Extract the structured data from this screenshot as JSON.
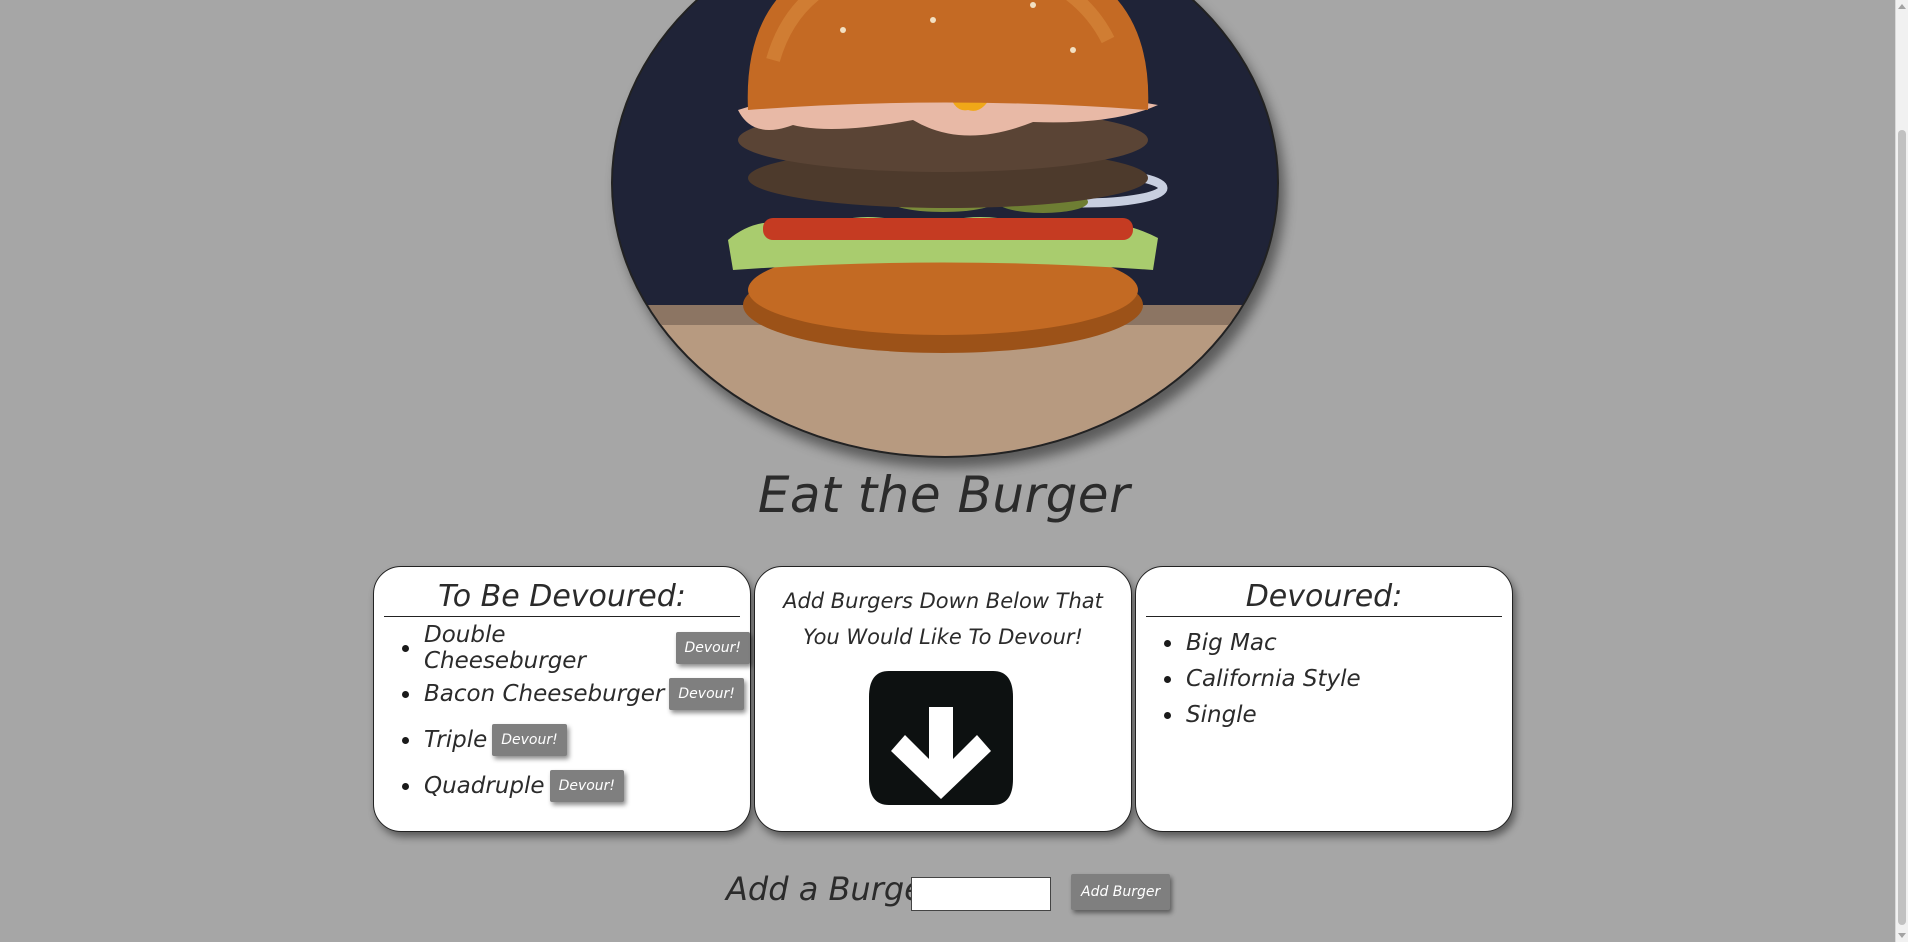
{
  "page": {
    "title": "Eat the Burger"
  },
  "hero": {
    "icon": "burger-photo",
    "colors": {
      "background": "#1e2236",
      "bun": "#b85c1c",
      "sauce": "#e6b9a6",
      "lettuce": "#a6c86a"
    }
  },
  "to_be_devoured": {
    "heading": "To Be Devoured:",
    "button_label": "Devour!",
    "items": [
      {
        "name": "Double Cheeseburger"
      },
      {
        "name": "Bacon Cheeseburger"
      },
      {
        "name": "Triple"
      },
      {
        "name": "Quadruple"
      }
    ]
  },
  "instructions": {
    "text": "Add Burgers Down Below That You Would Like To Devour!",
    "icon": "arrow-down-icon"
  },
  "devoured": {
    "heading": "Devoured:",
    "items": [
      {
        "name": "Big Mac"
      },
      {
        "name": "California Style"
      },
      {
        "name": "Single"
      }
    ]
  },
  "add_form": {
    "label": "Add a Burger:",
    "input_value": "",
    "button_label": "Add Burger"
  },
  "colors": {
    "page_background": "#a6a6a6",
    "button_background": "#7f7f7f",
    "card_background": "#ffffff"
  }
}
